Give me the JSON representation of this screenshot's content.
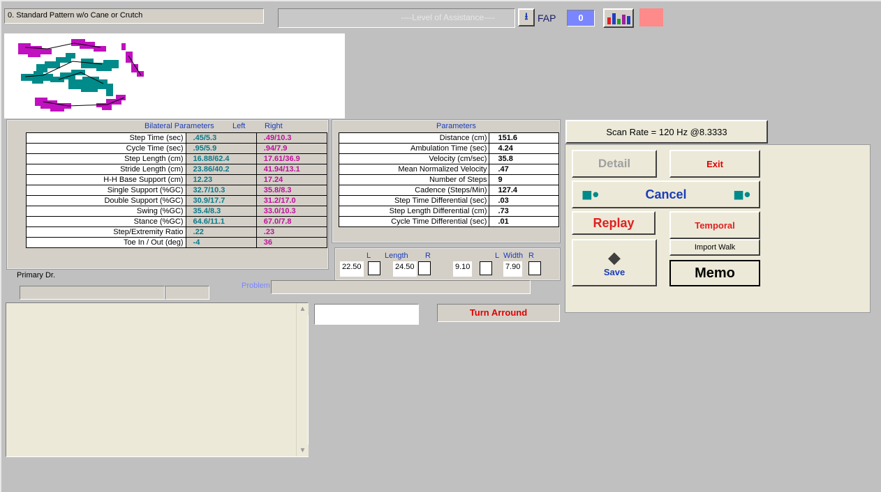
{
  "pattern_title": "0. Standard Pattern w/o Cane or Crutch",
  "level_of_assistance": "----Level of Assistance----",
  "fap": {
    "label": "FAP",
    "value": "0"
  },
  "accent_color": "#ff8a8a",
  "bilateral": {
    "title": "Bilateral Parameters",
    "left_header": "Left",
    "right_header": "Right",
    "rows": [
      {
        "label": "Step Time (sec)",
        "left": ".45/5.3",
        "right": ".49/10.3"
      },
      {
        "label": "Cycle Time (sec)",
        "left": ".95/5.9",
        "right": ".94/7.9"
      },
      {
        "label": "Step Length (cm)",
        "left": "16.88/62.4",
        "right": "17.61/36.9"
      },
      {
        "label": "Stride Length (cm)",
        "left": "23.86/40.2",
        "right": "41.94/13.1"
      },
      {
        "label": "H-H Base Support (cm)",
        "left": "12.23",
        "right": "17.24"
      },
      {
        "label": "Single Support (%GC)",
        "left": "32.7/10.3",
        "right": "35.8/8.3"
      },
      {
        "label": "Double Support (%GC)",
        "left": "30.9/17.7",
        "right": "31.2/17.0"
      },
      {
        "label": "Swing (%GC)",
        "left": "35.4/8.3",
        "right": "33.0/10.3"
      },
      {
        "label": "Stance (%GC)",
        "left": "64.6/11.1",
        "right": "67.0/7.8"
      },
      {
        "label": "Step/Extremity Ratio",
        "left": ".22",
        "right": ".23"
      },
      {
        "label": "Toe In / Out (deg)",
        "left": "-4",
        "right": "36"
      }
    ]
  },
  "parameters": {
    "title": "Parameters",
    "rows": [
      {
        "label": "Distance (cm)",
        "value": "151.6"
      },
      {
        "label": "Ambulation Time (sec)",
        "value": "4.24"
      },
      {
        "label": "Velocity (cm/sec)",
        "value": "35.8"
      },
      {
        "label": "Mean Normalized Velocity",
        "value": ".47"
      },
      {
        "label": "Number of Steps",
        "value": "9"
      },
      {
        "label": "Cadence (Steps/Min)",
        "value": "127.4"
      },
      {
        "label": "Step Time Differential (sec)",
        "value": ".03"
      },
      {
        "label": "Step Length Differential (cm)",
        "value": ".73"
      },
      {
        "label": "Cycle Time Differential (sec)",
        "value": ".01"
      }
    ]
  },
  "length_width": {
    "l1": "L",
    "length": "Length",
    "r1": "R",
    "l2": "L",
    "width": "Width",
    "r2": "R",
    "length_left": "22.50",
    "length_right": "24.50",
    "width_left": "9.10",
    "width_right": "7.90"
  },
  "primary_dr_label": "Primary Dr.",
  "problem_label": "Problem",
  "turn_around": "Turn Arround",
  "scan_rate": "Scan Rate = 120 Hz @8.3333",
  "buttons": {
    "detail": "Detail",
    "exit": "Exit",
    "cancel": "Cancel",
    "replay": "Replay",
    "temporal": "Temporal",
    "import_walk": "Import Walk",
    "save": "Save",
    "memo": "Memo"
  }
}
